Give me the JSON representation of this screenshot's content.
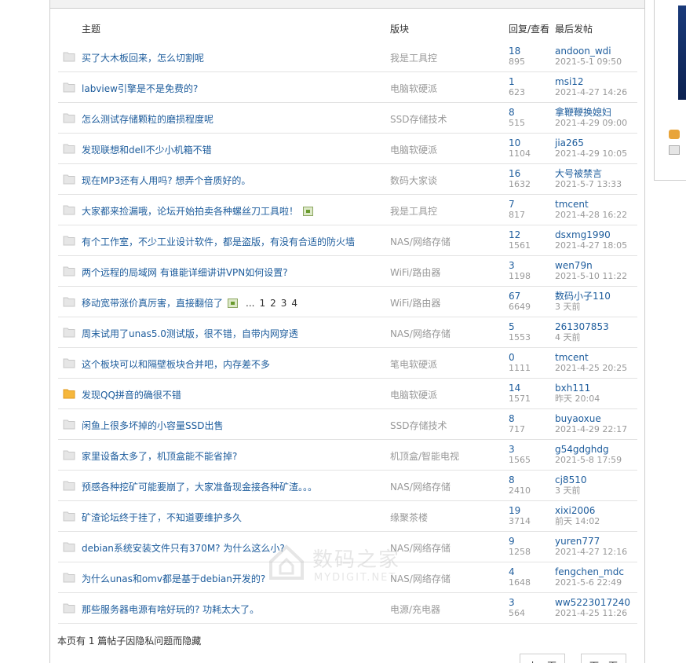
{
  "header": {
    "col_title": "主题",
    "col_forum": "版块",
    "col_stats": "回复/查看",
    "col_last": "最后发帖"
  },
  "colors": {
    "link": "#1d5c9c",
    "muted": "#999999",
    "border": "#e3e3e3",
    "new_folder": "#f6b73c",
    "folder": "#d9d9d9"
  },
  "threads": [
    {
      "title": "买了大木板回来，怎么切割呢",
      "forum": "我是工具控",
      "replies": "18",
      "views": "895",
      "author": "andoon_wdi",
      "time": "2021-5-1 09:50",
      "icon": "folder-icon"
    },
    {
      "title": "labview引擎是不是免费的?",
      "forum": "电脑软硬派",
      "replies": "1",
      "views": "623",
      "author": "msi12",
      "time": "2021-4-27 14:26",
      "icon": "folder-icon"
    },
    {
      "title": "怎么测试存储颗粒的磨损程度呢",
      "forum": "SSD存储技术",
      "replies": "8",
      "views": "515",
      "author": "拿鞭鞭换媳妇",
      "time": "2021-4-29 09:00",
      "icon": "folder-icon"
    },
    {
      "title": "发现联想和dell不少小机箱不错",
      "forum": "电脑软硬派",
      "replies": "10",
      "views": "1104",
      "author": "jia265",
      "time": "2021-4-29 10:05",
      "icon": "folder-icon"
    },
    {
      "title": "现在MP3还有人用吗? 想弄个音质好的。",
      "forum": "数码大家谈",
      "replies": "16",
      "views": "1632",
      "author": "大号被禁言",
      "time": "2021-5-7 13:33",
      "icon": "folder-icon"
    },
    {
      "title": "大家都来捡漏哦，论坛开始拍卖各种螺丝刀工具啦！",
      "forum": "我是工具控",
      "replies": "7",
      "views": "817",
      "author": "tmcent",
      "time": "2021-4-28 16:22",
      "icon": "folder-icon",
      "attach": true
    },
    {
      "title": "有个工作室，不少工业设计软件，都是盗版，有没有合适的防火墙",
      "forum": "NAS/网络存储",
      "replies": "12",
      "views": "1561",
      "author": "dsxmg1990",
      "time": "2021-4-27 18:05",
      "icon": "folder-icon"
    },
    {
      "title": "两个远程的局域网 有谁能详细讲讲VPN如何设置?",
      "forum": "WiFi/路由器",
      "replies": "3",
      "views": "1198",
      "author": "wen79n",
      "time": "2021-5-10 11:22",
      "icon": "folder-icon"
    },
    {
      "title": "移动宽带涨价真厉害，直接翻倍了",
      "forum": "WiFi/路由器",
      "replies": "67",
      "views": "6649",
      "author": "数码小子110",
      "time": "3 天前",
      "icon": "folder-icon",
      "attach": true,
      "pages": [
        "...",
        "1",
        "2",
        "3",
        "4"
      ]
    },
    {
      "title": "周末试用了unas5.0测试版，很不错，自带内网穿透",
      "forum": "NAS/网络存储",
      "replies": "5",
      "views": "1553",
      "author": "261307853",
      "time": "4 天前",
      "icon": "folder-icon"
    },
    {
      "title": "这个板块可以和隔壁板块合并吧，内存差不多",
      "forum": "笔电软硬派",
      "replies": "0",
      "views": "1111",
      "author": "tmcent",
      "time": "2021-4-25 20:25",
      "icon": "folder-icon"
    },
    {
      "title": "发现QQ拼音的确很不错",
      "forum": "电脑软硬派",
      "replies": "14",
      "views": "1571",
      "author": "bxh111",
      "time": "昨天 20:04",
      "icon": "new-folder-icon"
    },
    {
      "title": "闲鱼上很多坏掉的小容量SSD出售",
      "forum": "SSD存储技术",
      "replies": "8",
      "views": "717",
      "author": "buyaoxue",
      "time": "2021-4-29 22:17",
      "icon": "folder-icon"
    },
    {
      "title": "家里设备太多了，机顶盒能不能省掉?",
      "forum": "机顶盒/智能电视",
      "replies": "3",
      "views": "1565",
      "author": "g54gdghdg",
      "time": "2021-5-8 17:59",
      "icon": "folder-icon"
    },
    {
      "title": "预感各种挖矿可能要崩了，大家准备现金接各种矿渣。。。",
      "forum": "NAS/网络存储",
      "replies": "8",
      "views": "2410",
      "author": "cj8510",
      "time": "3 天前",
      "icon": "folder-icon"
    },
    {
      "title": "矿渣论坛终于挂了，不知道要维护多久",
      "forum": "缘聚茶楼",
      "replies": "19",
      "views": "3714",
      "author": "xixi2006",
      "time": "前天 14:02",
      "icon": "folder-icon"
    },
    {
      "title": "debian系统安装文件只有370M? 为什么这么小?",
      "forum": "NAS/网络存储",
      "replies": "9",
      "views": "1258",
      "author": "yuren777",
      "time": "2021-4-27 12:16",
      "icon": "folder-icon"
    },
    {
      "title": "为什么unas和omv都是基于debian开发的?",
      "forum": "NAS/网络存储",
      "replies": "4",
      "views": "1648",
      "author": "fengchen_mdc",
      "time": "2021-5-6 22:49",
      "icon": "folder-icon"
    },
    {
      "title": "那些服务器电源有啥好玩的? 功耗太大了。",
      "forum": "电源/充电器",
      "replies": "3",
      "views": "564",
      "author": "ww5223017240",
      "time": "2021-4-25 11:26",
      "icon": "folder-icon"
    }
  ],
  "footer": {
    "hidden_note": "本页有 1 篇帖子因隐私问题而隐藏",
    "prev_label": "上一页",
    "next_label": "下一页"
  },
  "watermark": {
    "cn": "数码之家",
    "en": "MYDIGIT.NET"
  }
}
